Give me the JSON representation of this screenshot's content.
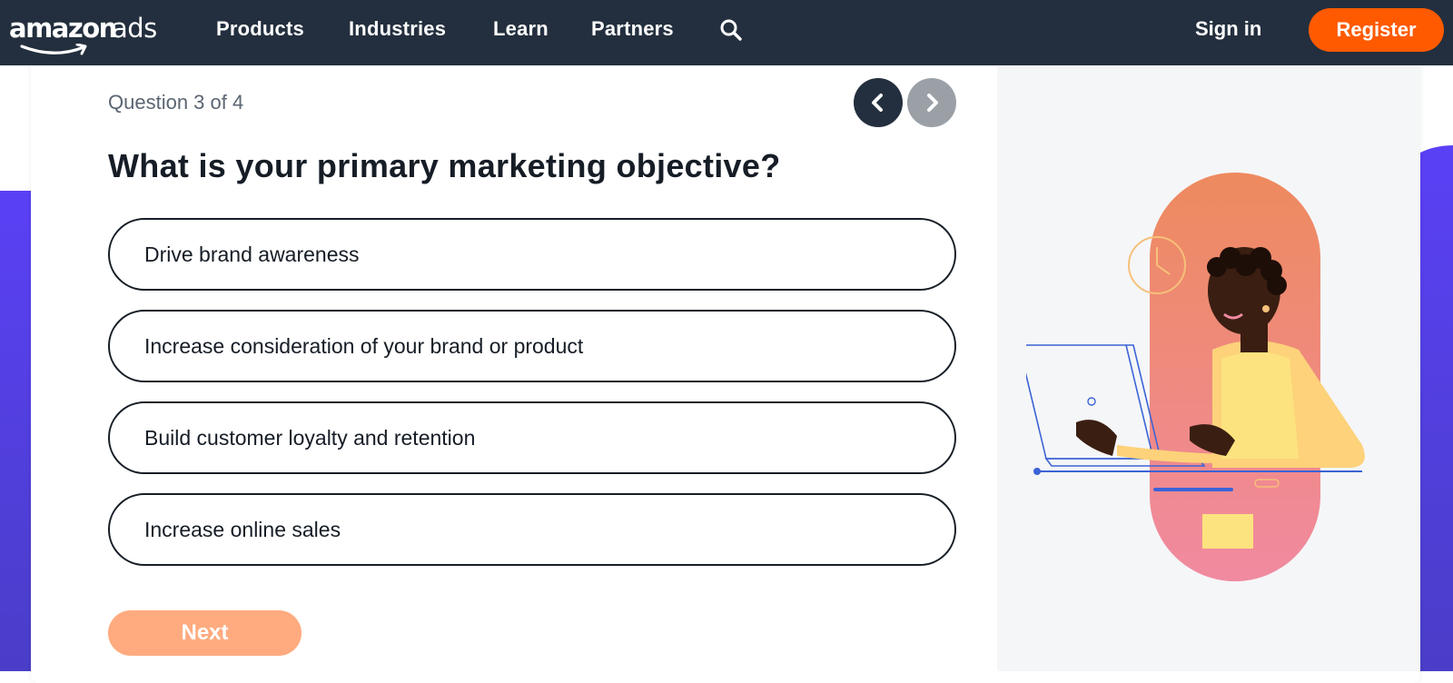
{
  "brand": {
    "logo_text_primary": "amazon",
    "logo_text_secondary": "ads",
    "accent": "#ff5a00",
    "nav_bg": "#232f3e"
  },
  "nav": {
    "items": [
      {
        "label": "Products"
      },
      {
        "label": "Industries"
      },
      {
        "label": "Learn"
      },
      {
        "label": "Partners"
      }
    ],
    "search_icon": "search-icon",
    "signin_label": "Sign in",
    "register_label": "Register"
  },
  "quiz": {
    "progress": "Question 3 of 4",
    "question": "What is your primary marketing objective?",
    "options": [
      {
        "label": "Drive brand awareness"
      },
      {
        "label": "Increase consideration of your brand or product"
      },
      {
        "label": "Build customer loyalty and retention"
      },
      {
        "label": "Increase online sales"
      }
    ],
    "prev_icon": "chevron-left-icon",
    "next_icon": "chevron-right-icon",
    "next_label": "Next"
  }
}
